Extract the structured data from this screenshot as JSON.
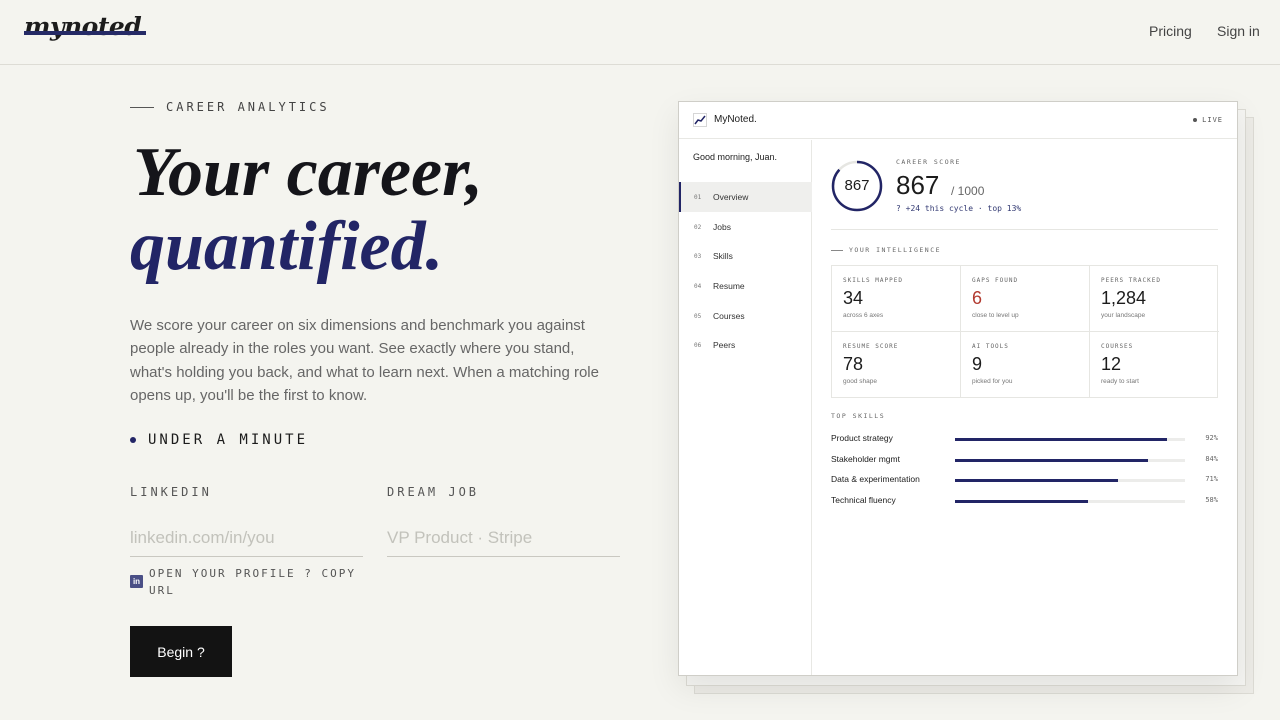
{
  "header": {
    "logo": "mynoted",
    "nav": [
      "Pricing",
      "Sign in"
    ]
  },
  "hero": {
    "eyebrow": "CAREER ANALYTICS",
    "title_line1": "Your career,",
    "title_line2": "quantified.",
    "lede": "We score your career on six dimensions and benchmark you against people already in the roles you want. See exactly where you stand, what's holding you back, and what to learn next. When a matching role opens up, you'll be the first to know.",
    "tagline": "UNDER A MINUTE"
  },
  "form": {
    "linkedin_label": "LINKEDIN",
    "linkedin_placeholder": "linkedin.com/in/you",
    "dream_label": "DREAM JOB",
    "dream_placeholder": "VP Product · Stripe",
    "linkedin_hint": "OPEN YOUR PROFILE ? COPY URL",
    "linkedin_icon_text": "in",
    "submit_label": "Begin ?"
  },
  "dashboard": {
    "brand": "MyNoted.",
    "live": "LIVE",
    "greeting": "Good morning, Juan.",
    "nav": [
      {
        "num": "01",
        "label": "Overview",
        "active": true
      },
      {
        "num": "02",
        "label": "Jobs",
        "active": false
      },
      {
        "num": "03",
        "label": "Skills",
        "active": false
      },
      {
        "num": "04",
        "label": "Resume",
        "active": false
      },
      {
        "num": "05",
        "label": "Courses",
        "active": false
      },
      {
        "num": "06",
        "label": "Peers",
        "active": false
      }
    ],
    "score": {
      "label": "CAREER SCORE",
      "value": "867",
      "out_of": "/ 1000",
      "fraction": 0.867,
      "delta": "? +24 this cycle · top 13%"
    },
    "intel_label": "YOUR INTELLIGENCE",
    "stats": [
      {
        "label": "SKILLS MAPPED",
        "value": "34",
        "sub": "across 6 axes",
        "highlight": false
      },
      {
        "label": "GAPS FOUND",
        "value": "6",
        "sub": "close to level up",
        "highlight": true
      },
      {
        "label": "PEERS TRACKED",
        "value": "1,284",
        "sub": "your landscape",
        "highlight": false
      },
      {
        "label": "RESUME SCORE",
        "value": "78",
        "sub": "good shape",
        "highlight": false
      },
      {
        "label": "AI TOOLS",
        "value": "9",
        "sub": "picked for you",
        "highlight": false
      },
      {
        "label": "COURSES",
        "value": "12",
        "sub": "ready to start",
        "highlight": false
      }
    ],
    "skills_label": "TOP SKILLS",
    "skills": [
      {
        "name": "Product strategy",
        "pct": "92%",
        "value": 92
      },
      {
        "name": "Stakeholder mgmt",
        "pct": "84%",
        "value": 84
      },
      {
        "name": "Data & experimentation",
        "pct": "71%",
        "value": 71
      },
      {
        "name": "Technical fluency",
        "pct": "58%",
        "value": 58
      }
    ]
  },
  "colors": {
    "accent": "#222566",
    "background": "#f4f4ef",
    "warning": "#b23a30"
  },
  "icons": [
    "linkedin-icon",
    "mynoted-logo-icon",
    "live-dot-icon"
  ]
}
